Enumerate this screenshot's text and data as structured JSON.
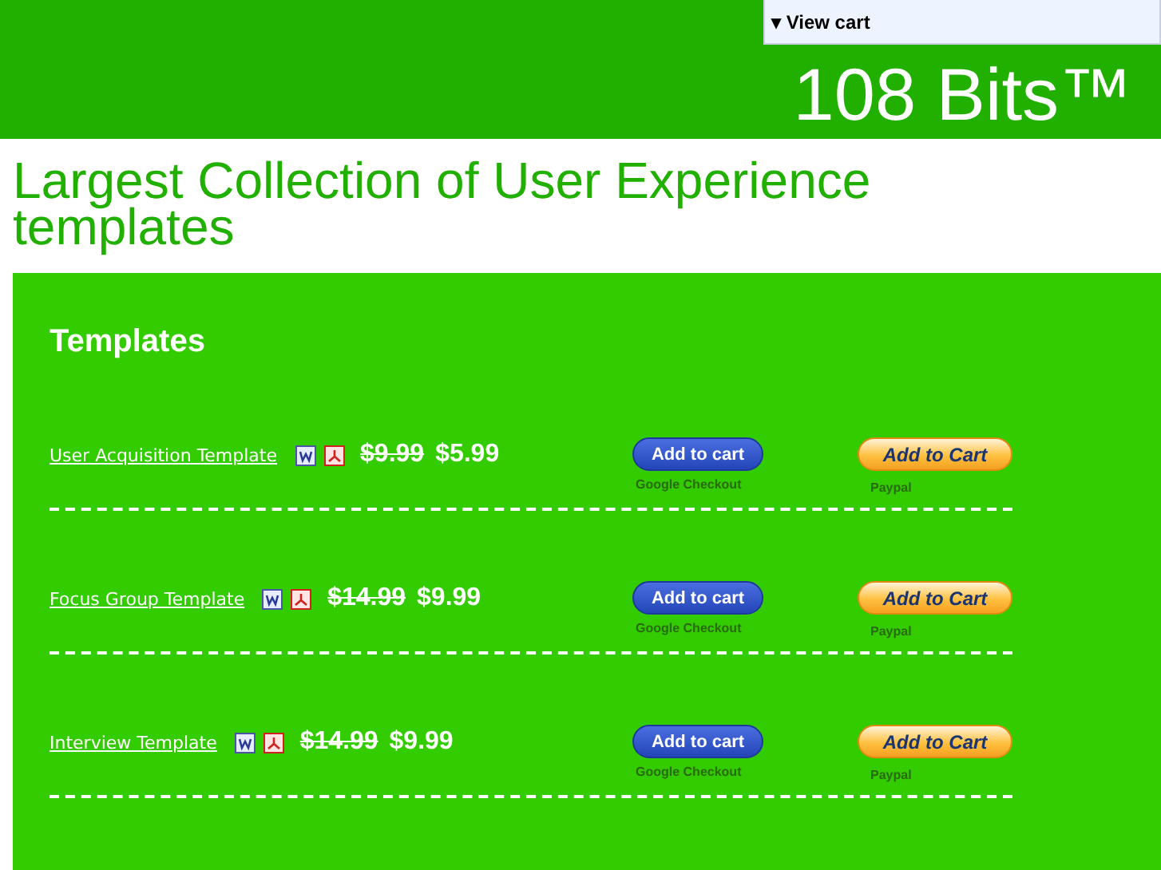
{
  "header": {
    "cart_toggle": {
      "arrow": "▾",
      "label": "View cart"
    },
    "brand": "108 Bits™"
  },
  "headline": "Largest Collection of User Experience templates",
  "section": {
    "title": "Templates",
    "products": [
      {
        "name": "User Acquisition Template",
        "old_price": "$9.99",
        "price": "$5.99",
        "google": {
          "button": "Add to cart",
          "caption": "Google Checkout"
        },
        "paypal": {
          "button": "Add to Cart",
          "caption": "Paypal"
        }
      },
      {
        "name": "Focus Group Template",
        "old_price": "$14.99",
        "price": "$9.99",
        "google": {
          "button": "Add to cart",
          "caption": "Google Checkout"
        },
        "paypal": {
          "button": "Add to Cart",
          "caption": "Paypal"
        }
      },
      {
        "name": "Interview Template",
        "old_price": "$14.99",
        "price": "$9.99",
        "google": {
          "button": "Add to cart",
          "caption": "Google Checkout"
        },
        "paypal": {
          "button": "Add to Cart",
          "caption": "Paypal"
        }
      }
    ]
  }
}
